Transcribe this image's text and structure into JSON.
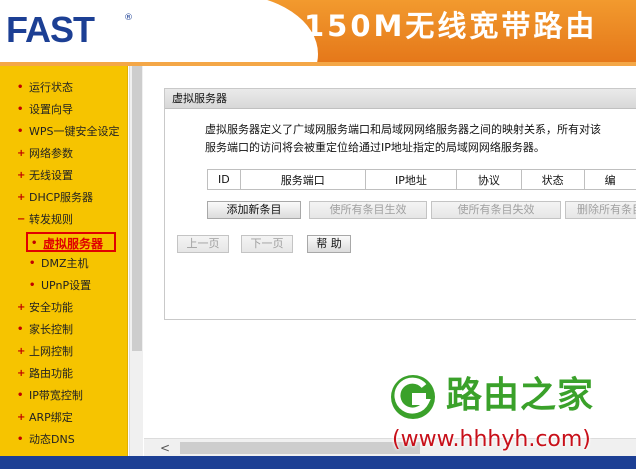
{
  "header": {
    "brand": "FAST",
    "brand_mark": "®",
    "product_title": "150M无线宽带路由"
  },
  "sidebar": {
    "items": [
      {
        "label": "运行状态",
        "marker": "•"
      },
      {
        "label": "设置向导",
        "marker": "•"
      },
      {
        "label": "WPS一键安全设定",
        "marker": "•"
      },
      {
        "label": "网络参数",
        "marker": "+"
      },
      {
        "label": "无线设置",
        "marker": "+"
      },
      {
        "label": "DHCP服务器",
        "marker": "+"
      },
      {
        "label": "转发规则",
        "marker": "−"
      },
      {
        "label": "虚拟服务器",
        "marker": "•",
        "sub": true,
        "active": true
      },
      {
        "label": "DMZ主机",
        "marker": "•",
        "sub": true
      },
      {
        "label": "UPnP设置",
        "marker": "•",
        "sub": true
      },
      {
        "label": "安全功能",
        "marker": "+"
      },
      {
        "label": "家长控制",
        "marker": "•"
      },
      {
        "label": "上网控制",
        "marker": "+"
      },
      {
        "label": "路由功能",
        "marker": "+"
      },
      {
        "label": "IP带宽控制",
        "marker": "•"
      },
      {
        "label": "ARP绑定",
        "marker": "+"
      },
      {
        "label": "动态DNS",
        "marker": "•"
      }
    ]
  },
  "panel": {
    "title": "虚拟服务器",
    "description_line1": "虚拟服务器定义了广域网服务端口和局域网网络服务器之间的映射关系，所有对该",
    "description_line2": "服务端口的访问将会被重定位给通过IP地址指定的局域网网络服务器。",
    "table_headers": [
      "ID",
      "服务端口",
      "IP地址",
      "协议",
      "状态",
      "编"
    ],
    "buttons": {
      "add_new": "添加新条目",
      "enable_all": "使所有条目生效",
      "disable_all": "使所有条目失效",
      "delete_all": "删除所有条目"
    },
    "pager": {
      "prev": "上一页",
      "next": "下一页",
      "help": "帮 助"
    }
  },
  "scrollbar": {
    "left_arrow": "<"
  },
  "watermark": {
    "name": "路由之家",
    "url": "(www.hhhyh.com)"
  },
  "colors": {
    "header_orange": "#f29a2e",
    "brand_blue": "#1c3f94",
    "sidebar_yellow": "#f6c400",
    "active_red": "#e00000",
    "watermark_green": "#3aa12a",
    "watermark_red": "#c8101a"
  }
}
